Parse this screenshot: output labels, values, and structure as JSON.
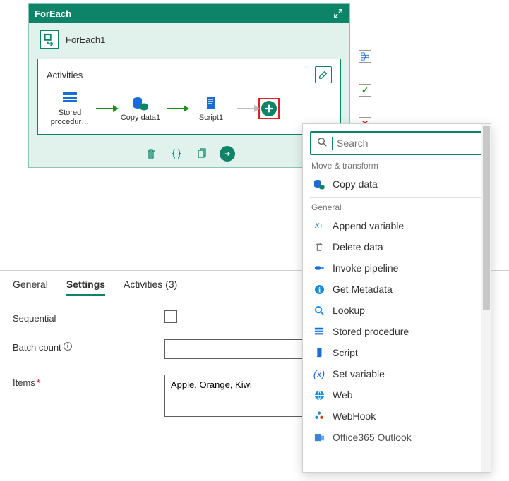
{
  "foreach": {
    "title": "ForEach",
    "name": "ForEach1",
    "activities_label": "Activities",
    "nodes": [
      {
        "label": "Stored procedur…"
      },
      {
        "label": "Copy data1"
      },
      {
        "label": "Script1"
      }
    ]
  },
  "tabs": {
    "general": "General",
    "settings": "Settings",
    "activities": "Activities (3)"
  },
  "form": {
    "sequential_label": "Sequential",
    "batch_label": "Batch count",
    "items_label": "Items",
    "items_value": "Apple, Orange, Kiwi",
    "batch_value": ""
  },
  "picker": {
    "search_placeholder": "Search",
    "groups": [
      {
        "label": "Move & transform",
        "items": [
          "Copy data"
        ]
      },
      {
        "label": "General",
        "items": [
          "Append variable",
          "Delete data",
          "Invoke pipeline",
          "Get Metadata",
          "Lookup",
          "Stored procedure",
          "Script",
          "Set variable",
          "Web",
          "WebHook",
          "Office365 Outlook"
        ]
      }
    ]
  }
}
